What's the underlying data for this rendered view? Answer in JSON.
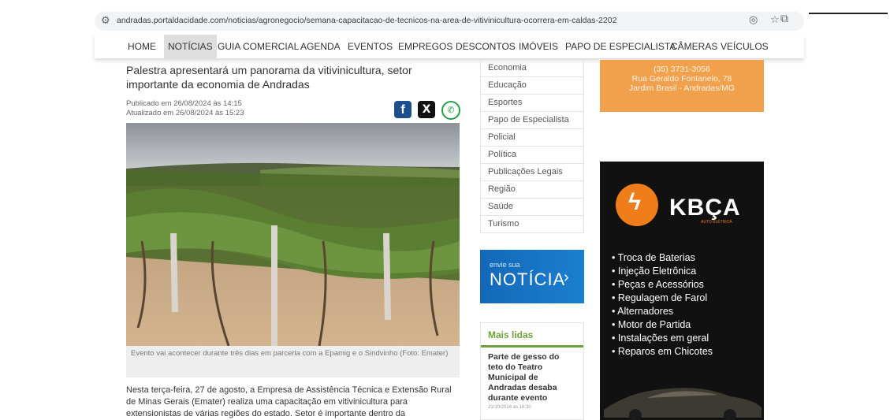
{
  "browser": {
    "url": "andradas.portaldacidade.com/noticias/agronegocio/semana-capacitacao-de-tecnicos-na-area-de-vitivinicultura-ocorrera-em-caldas-2202",
    "icons": [
      "tune-icon",
      "eye-off-icon",
      "star-icon",
      "extensions-icon"
    ]
  },
  "nav": {
    "items": [
      "HOME",
      "NOTÍCIAS",
      "GUIA COMERCIAL",
      "AGENDA",
      "EVENTOS",
      "EMPREGOS",
      "DESCONTOS",
      "IMÓVEIS",
      "PAPO DE ESPECIALISTA",
      "CÂMERAS",
      "VEÍCULOS"
    ],
    "active": "NOTÍCIAS"
  },
  "article": {
    "title": "Palestra apresentará um panorama da vitivinicultura, setor importante da economia de Andradas",
    "published": "Publicado em 26/08/2024 às 14:15",
    "updated": "Atualizado em 26/08/2024 às 15:23",
    "share": {
      "facebook": "f",
      "x": "X",
      "whatsapp": "✆"
    },
    "caption": "Evento vai acontecer durante três dias em parceria com a Epamig e o Sindvinho (Foto: Emater)",
    "body": "Nesta terça-feira, 27 de agosto, a Empresa de Assistência Técnica e Extensão Rural de Minas Gerais (Emater) realiza uma capacitação em vitivinicultura para extensionistas de várias regiões do estado. Setor é importante dentro da"
  },
  "categories": [
    "Economia",
    "Educação",
    "Esportes",
    "Papo de Especialista",
    "Policial",
    "Política",
    "Publicações Legais",
    "Região",
    "Saúde",
    "Turismo"
  ],
  "envie": {
    "small": "envie sua",
    "big": "NOTÍCIA",
    "arrow": "›"
  },
  "mais_lidas": {
    "heading": "Mais lidas",
    "item": "Parte de gesso do teto do Teatro Municipal de Andradas desaba durante evento",
    "date": "21/10/2024 às 16:30"
  },
  "ad_top": {
    "line1": "(35) 3731-3056",
    "line2": "Rua Geraldo Fontanelo, 78",
    "line3": "Jardim Brasil - Andradas/MG"
  },
  "ad_kbca": {
    "brand": "KBÇA",
    "sub": "AUTO ELÉTRICA",
    "services": [
      "• Troca de Baterias",
      "• Injeção Eletrônica",
      "• Peças e Acessórios",
      "• Regulagem de Farol",
      "• Alternadores",
      "• Motor de Partida",
      "• Instalações em geral",
      "• Reparos em Chicotes"
    ]
  },
  "colors": {
    "green": "#6da13a",
    "blue": "#1468b8",
    "orange": "#ef7d1a",
    "ad_orange": "#f1a14c"
  }
}
